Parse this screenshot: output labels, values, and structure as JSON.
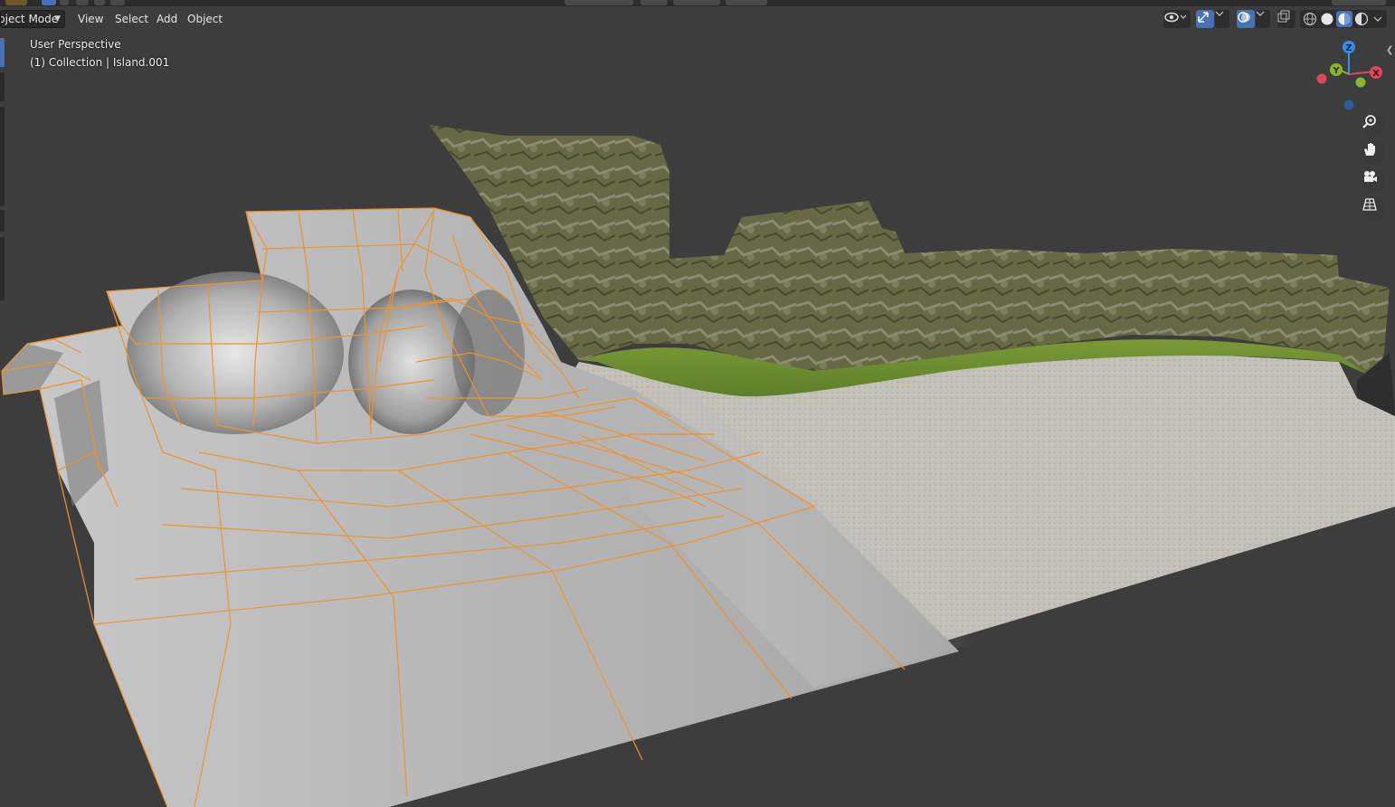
{
  "header": {
    "mode": "Object Mode",
    "mode_visible": "bject Mode",
    "menus": [
      "View",
      "Select",
      "Add",
      "Object"
    ]
  },
  "viewport": {
    "perspective": "User Perspective",
    "collection": "(1) Collection | Island.001"
  },
  "gizmo": {
    "axes": [
      "Z",
      "Y",
      "X"
    ],
    "colors": {
      "x": "#e0475b",
      "y": "#8ab531",
      "z": "#3b8ee8"
    }
  },
  "nav_icons": [
    "zoom-icon",
    "pan-hand-icon",
    "camera-icon",
    "grid-icon"
  ],
  "shading": {
    "active": "material-preview",
    "modes": [
      "wireframe",
      "solid",
      "material-preview",
      "rendered"
    ]
  },
  "colors": {
    "background": "#3d3d3d",
    "selection_outline": "#f0922c",
    "accent": "#4772b3"
  }
}
